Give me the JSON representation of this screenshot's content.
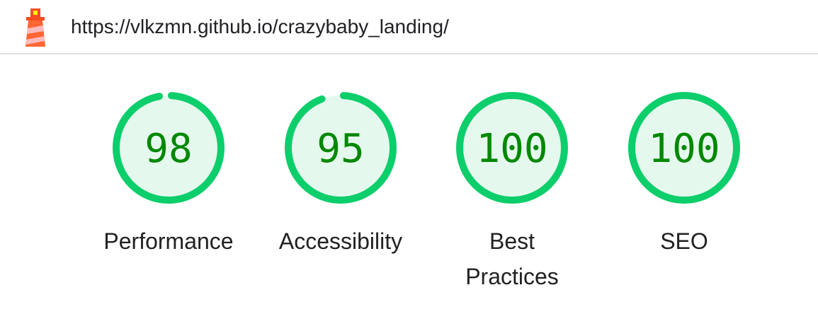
{
  "header": {
    "url": "https://vlkzmn.github.io/crazybaby_landing/",
    "logo_icon": "lighthouse-icon"
  },
  "colors": {
    "pass_ring": "#0cce6b",
    "pass_fill": "#e5f8ee",
    "pass_text": "#008800"
  },
  "gauges": [
    {
      "score": "98",
      "label": "Performance",
      "value": 98
    },
    {
      "score": "95",
      "label": "Accessibility",
      "value": 95
    },
    {
      "score": "100",
      "label": "Best Practices",
      "value": 100
    },
    {
      "score": "100",
      "label": "SEO",
      "value": 100
    }
  ]
}
